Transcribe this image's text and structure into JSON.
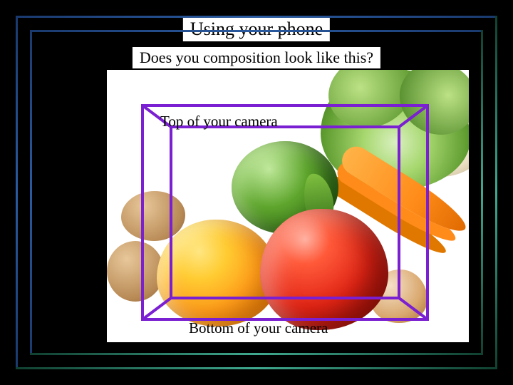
{
  "slide": {
    "title": "Using your phone",
    "subtitle": "Does you composition look like this?",
    "camera_label_top": "Top of your camera",
    "camera_label_bottom": "Bottom of your camera"
  },
  "colors": {
    "frame_blue": "#2a5aa0",
    "frame_teal": "#3fa98f",
    "camera_outline": "#7a1fd1"
  }
}
